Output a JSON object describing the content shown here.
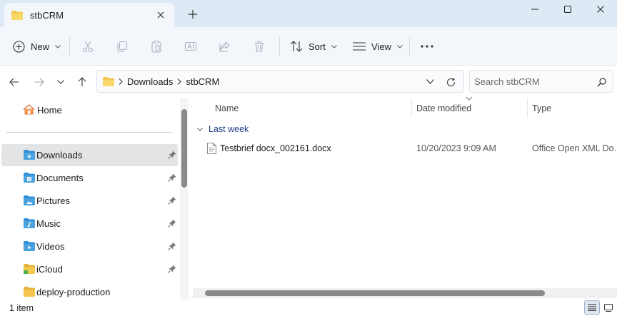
{
  "window": {
    "tab_title": "stbCRM",
    "controls": [
      "minimize",
      "maximize",
      "close"
    ]
  },
  "toolbar": {
    "new_label": "New",
    "sort_label": "Sort",
    "view_label": "View",
    "actions": [
      "cut",
      "copy",
      "paste",
      "rename",
      "share",
      "delete"
    ]
  },
  "address": {
    "breadcrumb": [
      "Downloads",
      "stbCRM"
    ]
  },
  "search": {
    "placeholder": "Search stbCRM"
  },
  "sidebar": {
    "home_label": "Home",
    "items": [
      {
        "label": "Downloads",
        "icon": "downloads-folder-icon",
        "pinned": true,
        "selected": true
      },
      {
        "label": "Documents",
        "icon": "documents-folder-icon",
        "pinned": true
      },
      {
        "label": "Pictures",
        "icon": "pictures-folder-icon",
        "pinned": true
      },
      {
        "label": "Music",
        "icon": "music-folder-icon",
        "pinned": true
      },
      {
        "label": "Videos",
        "icon": "videos-folder-icon",
        "pinned": true
      },
      {
        "label": "iCloud",
        "icon": "icloud-folder-icon",
        "pinned": true
      },
      {
        "label": "deploy-production",
        "icon": "folder-icon",
        "pinned": false
      }
    ]
  },
  "columns": {
    "name": "Name",
    "date_modified": "Date modified",
    "type": "Type"
  },
  "group": {
    "label": "Last week"
  },
  "files": [
    {
      "name": "Testbrief docx_002161.docx",
      "date_modified": "10/20/2023 9:09 AM",
      "type": "Office Open XML Do..."
    }
  ],
  "status": {
    "item_count": "1 item"
  },
  "colors": {
    "titlebar": "#dde9f5",
    "toolbar": "#f3f6fb",
    "selected": "#e3e4e6",
    "group_text": "#1f3c8a",
    "folder_yellow": "#f3c74d",
    "folder_blue": "#4aa3df"
  }
}
